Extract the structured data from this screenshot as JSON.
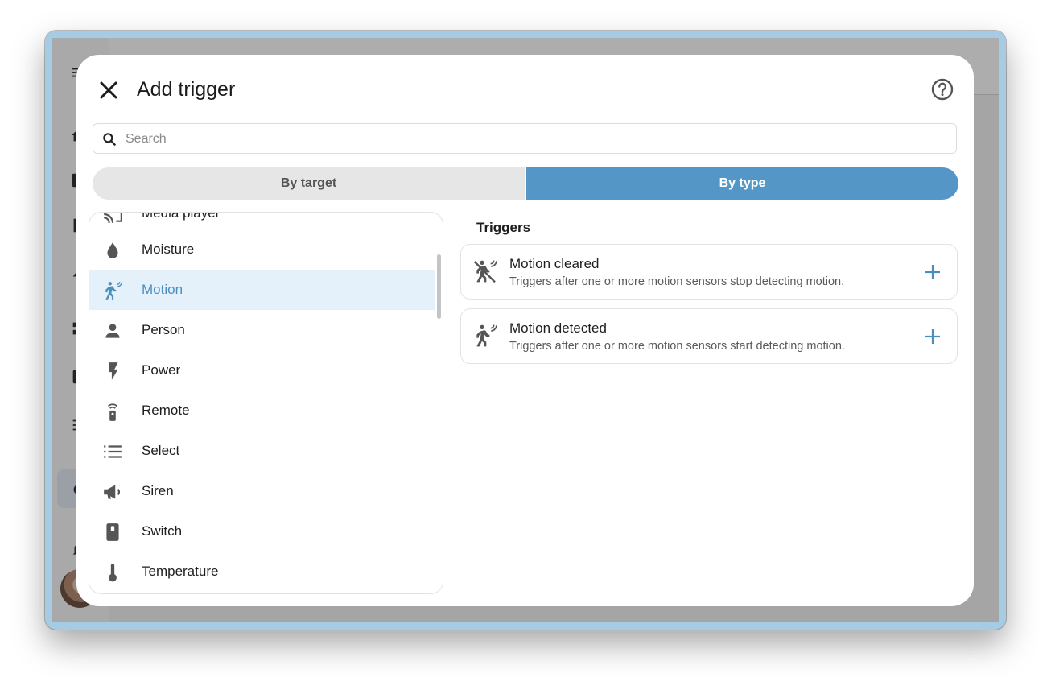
{
  "dialog": {
    "title": "Add trigger",
    "close_icon": "close-icon",
    "help_icon": "help-circle-icon"
  },
  "search": {
    "placeholder": "Search",
    "value": ""
  },
  "tabs": [
    {
      "label": "By target",
      "selected": false
    },
    {
      "label": "By type",
      "selected": true
    }
  ],
  "types_list": {
    "items": [
      {
        "label": "Media player",
        "icon": "cast-icon"
      },
      {
        "label": "Moisture",
        "icon": "water-drop-icon"
      },
      {
        "label": "Motion",
        "icon": "motion-sensor-icon",
        "selected": true
      },
      {
        "label": "Person",
        "icon": "person-icon"
      },
      {
        "label": "Power",
        "icon": "flash-icon"
      },
      {
        "label": "Remote",
        "icon": "remote-icon"
      },
      {
        "label": "Select",
        "icon": "format-list-icon"
      },
      {
        "label": "Siren",
        "icon": "bullhorn-icon"
      },
      {
        "label": "Switch",
        "icon": "switch-icon"
      },
      {
        "label": "Temperature",
        "icon": "thermometer-icon"
      }
    ]
  },
  "triggers": {
    "heading": "Triggers",
    "items": [
      {
        "title": "Motion cleared",
        "description": "Triggers after one or more motion sensors stop detecting motion.",
        "icon": "motion-sensor-off-icon"
      },
      {
        "title": "Motion detected",
        "description": "Triggers after one or more motion sensors start detecting motion.",
        "icon": "motion-sensor-icon"
      }
    ]
  },
  "colors": {
    "accent": "#5497c6",
    "selected_row": "#e4f0fa",
    "icon": "#555555"
  }
}
